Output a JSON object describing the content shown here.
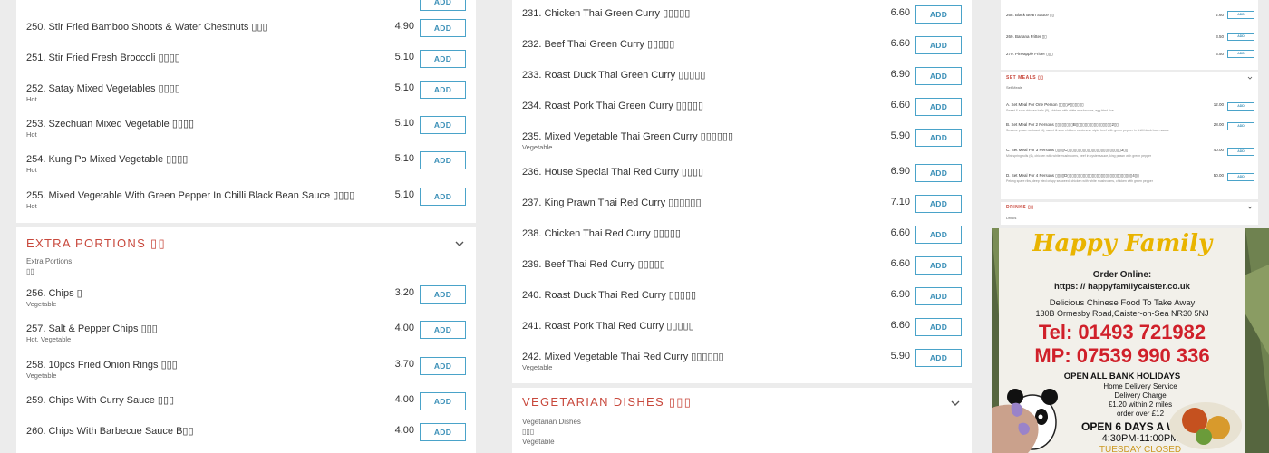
{
  "add_label": "ADD",
  "colors": {
    "accent": "#c8483c",
    "button_border": "#4aa3c9",
    "button_text": "#3a8fb7",
    "bg": "#ececec"
  },
  "col1": {
    "items": [
      {
        "name": "250. Stir Fried Bamboo Shoots & Water Chestnuts ▯▯▯",
        "tag": "",
        "price": "4.90"
      },
      {
        "name": "251. Stir Fried Fresh Broccoli ▯▯▯▯",
        "tag": "",
        "price": "5.10"
      },
      {
        "name": "252. Satay Mixed Vegetables ▯▯▯▯",
        "tag": "Hot",
        "price": "5.10"
      },
      {
        "name": "253. Szechuan Mixed Vegetable ▯▯▯▯",
        "tag": "Hot",
        "price": "5.10"
      },
      {
        "name": "254. Kung Po Mixed Vegetable ▯▯▯▯",
        "tag": "Hot",
        "price": "5.10"
      },
      {
        "name": "255. Mixed Vegetable With Green Pepper In Chilli Black Bean Sauce ▯▯▯▯",
        "tag": "Hot",
        "price": "5.10"
      }
    ],
    "section": {
      "title": "EXTRA PORTIONS ▯▯",
      "desc": "Extra Portions",
      "desc2": "▯▯",
      "items": [
        {
          "name": "256. Chips ▯",
          "tag": "Vegetable",
          "price": "3.20"
        },
        {
          "name": "257. Salt & Pepper Chips ▯▯▯",
          "tag": "Hot, Vegetable",
          "price": "4.00"
        },
        {
          "name": "258. 10pcs Fried Onion Rings ▯▯▯",
          "tag": "Vegetable",
          "price": "3.70"
        },
        {
          "name": "259. Chips With Curry Sauce ▯▯▯",
          "tag": "",
          "price": "4.00"
        },
        {
          "name": "260. Chips With Barbecue Sauce B▯▯",
          "tag": "",
          "price": "4.00"
        }
      ]
    }
  },
  "col2": {
    "items": [
      {
        "name": "231. Chicken Thai Green Curry ▯▯▯▯▯",
        "tag": "",
        "price": "6.60"
      },
      {
        "name": "232. Beef Thai Green Curry ▯▯▯▯▯",
        "tag": "",
        "price": "6.60"
      },
      {
        "name": "233. Roast Duck Thai Green Curry ▯▯▯▯▯",
        "tag": "",
        "price": "6.90"
      },
      {
        "name": "234. Roast Pork Thai Green Curry ▯▯▯▯▯",
        "tag": "",
        "price": "6.60"
      },
      {
        "name": "235. Mixed Vegetable Thai Green Curry ▯▯▯▯▯▯",
        "tag": "Vegetable",
        "price": "5.90"
      },
      {
        "name": "236. House Special Thai Red Curry ▯▯▯▯",
        "tag": "",
        "price": "6.90"
      },
      {
        "name": "237. King Prawn Thai Red Curry ▯▯▯▯▯▯",
        "tag": "",
        "price": "7.10"
      },
      {
        "name": "238. Chicken Thai Red Curry ▯▯▯▯▯",
        "tag": "",
        "price": "6.60"
      },
      {
        "name": "239. Beef Thai Red Curry ▯▯▯▯▯",
        "tag": "",
        "price": "6.60"
      },
      {
        "name": "240. Roast Duck Thai Red Curry ▯▯▯▯▯",
        "tag": "",
        "price": "6.90"
      },
      {
        "name": "241. Roast Pork Thai Red Curry ▯▯▯▯▯",
        "tag": "",
        "price": "6.60"
      },
      {
        "name": "242. Mixed Vegetable Thai Red Curry ▯▯▯▯▯▯",
        "tag": "Vegetable",
        "price": "5.90"
      }
    ],
    "section": {
      "title": "VEGETARIAN DISHES ▯▯▯",
      "desc": "Vegetarian Dishes",
      "desc2": "▯▯▯",
      "desc3": "Vegetable"
    }
  },
  "col3": {
    "items": [
      {
        "name": "268. Black Bean Sauce ▯▯",
        "desc": "",
        "price": "2.60"
      },
      {
        "name": "269. Banana Fritter ▯▯",
        "desc": "",
        "price": "3.50"
      },
      {
        "name": "270. Pineapple Fritter ▯▯▯",
        "desc": "",
        "price": "3.50"
      }
    ],
    "set_meals": {
      "title": "SET MEALS ▯▯",
      "desc": "Set Meals",
      "items": [
        {
          "name": "A. Set Meal For One Person ▯▯▯▯A▯▯▯▯▯▯",
          "desc": "Sweet & sour chicken balls (8), chicken with white mushrooms, egg fried rice",
          "price": "12.00"
        },
        {
          "name": "B. Set Meal For 2 Persons ▯▯▯▯▯▯▯▯B▯▯▯▯▯▯▯▯▯▯▯▯▯▯▯▯2▯▯",
          "desc": "Sesame prawn on toast (4), sweet & sour chicken cantonese style, beef with green pepper in chilli black bean sauce",
          "price": "28.00"
        },
        {
          "name": "C. Set Meal For 3 Persons ▯▯▯▯C▯▯▯▯▯▯▯▯▯▯▯▯▯▯▯▯▯▯▯▯▯▯▯▯3▯▯",
          "desc": "Mini spring rolls (6), chicken with white mushrooms, beef in oyster sauce, king prawn with green pepper",
          "price": "40.00"
        },
        {
          "name": "D. Set Meal For 4 Persons ▯▯▯▯D▯▯▯▯▯▯▯▯▯▯▯▯▯▯▯▯▯▯▯▯▯▯▯▯▯▯▯▯▯4▯▯",
          "desc": "Peking spare ribs, deep fried crispy seaweed, chicken with white mushrooms, chicken with green pepper",
          "price": "50.00"
        }
      ]
    },
    "drinks": {
      "title": "DRINKS ▯▯",
      "desc": "Drinks"
    }
  },
  "flyer": {
    "brand": "Happy Family",
    "order_online": "Order Online:",
    "url": "https: // happyfamilycaister.co.uk",
    "tagline": "Delicious Chinese Food To Take Away",
    "address": "130B Ormesby Road,Caister-on-Sea NR30 5NJ",
    "tel": "Tel: 01493 721982",
    "mobile": "MP: 07539 990 336",
    "holidays": "OPEN ALL BANK HOLIDAYS",
    "delivery": "Home Delivery Service",
    "delivery_charge": "Delivery Charge",
    "delivery_detail": "£1.20 within 2 miles",
    "free_over": "order over £12",
    "open_days": "OPEN 6 DAYS A WEEK",
    "hours": "4:30PM-11:00PM",
    "closed": "TUESDAY CLOSED"
  }
}
